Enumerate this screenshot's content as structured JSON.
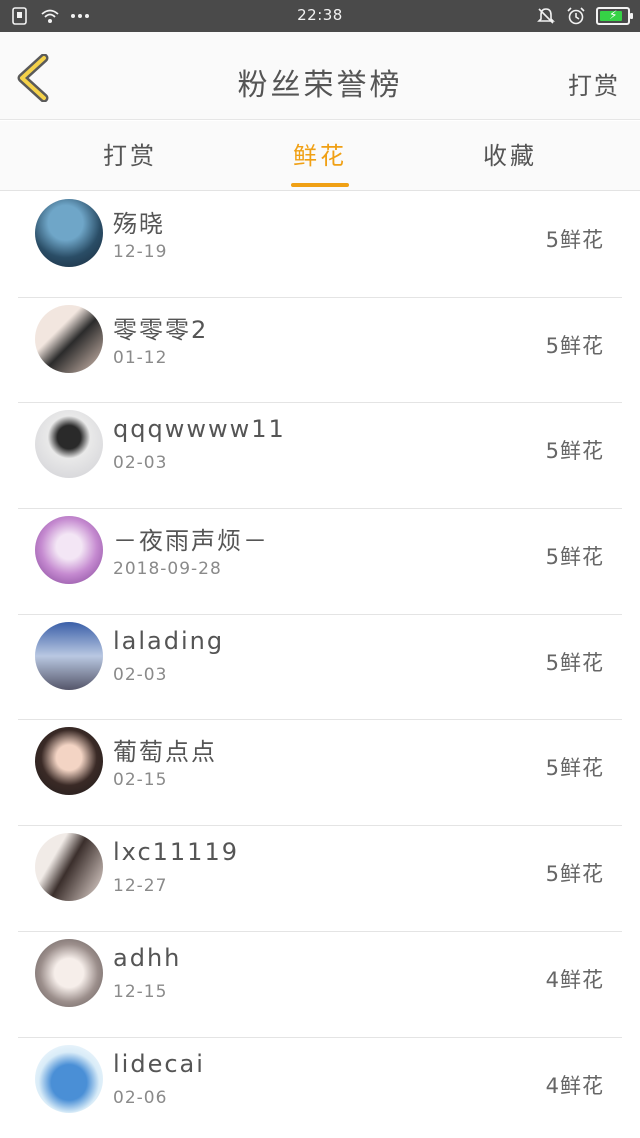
{
  "status_bar": {
    "time": "22:38",
    "left_icons": [
      "sim-card-icon",
      "wifi-icon",
      "more-dots-icon"
    ],
    "right_icons": [
      "mute-bell-icon",
      "alarm-icon",
      "battery-charging-icon"
    ],
    "battery_level": 0.85,
    "colors": {
      "background": "#4a4a4a",
      "battery": "#36d246"
    }
  },
  "header": {
    "back_icon": "chevron-left-icon",
    "title": "粉丝荣誉榜",
    "action_label": "打赏"
  },
  "tabs": [
    {
      "label": "打赏",
      "active": false
    },
    {
      "label": "鲜花",
      "active": true
    },
    {
      "label": "收藏",
      "active": false
    }
  ],
  "accent_color": "#f0a014",
  "fans": [
    {
      "name": "殇晓",
      "date": "12-19",
      "amount": "5鲜花"
    },
    {
      "name": "零零零2",
      "date": "01-12",
      "amount": "5鲜花"
    },
    {
      "name": "qqqwwww11",
      "date": "02-03",
      "amount": "5鲜花"
    },
    {
      "name": "－夜雨声烦－",
      "date": "2018-09-28",
      "amount": "5鲜花"
    },
    {
      "name": "lalading",
      "date": "02-03",
      "amount": "5鲜花"
    },
    {
      "name": "葡萄点点",
      "date": "02-15",
      "amount": "5鲜花"
    },
    {
      "name": "lxc11119",
      "date": "12-27",
      "amount": "5鲜花"
    },
    {
      "name": "adhh",
      "date": "12-15",
      "amount": "4鲜花"
    },
    {
      "name": "lidecai",
      "date": "02-06",
      "amount": "4鲜花"
    }
  ]
}
